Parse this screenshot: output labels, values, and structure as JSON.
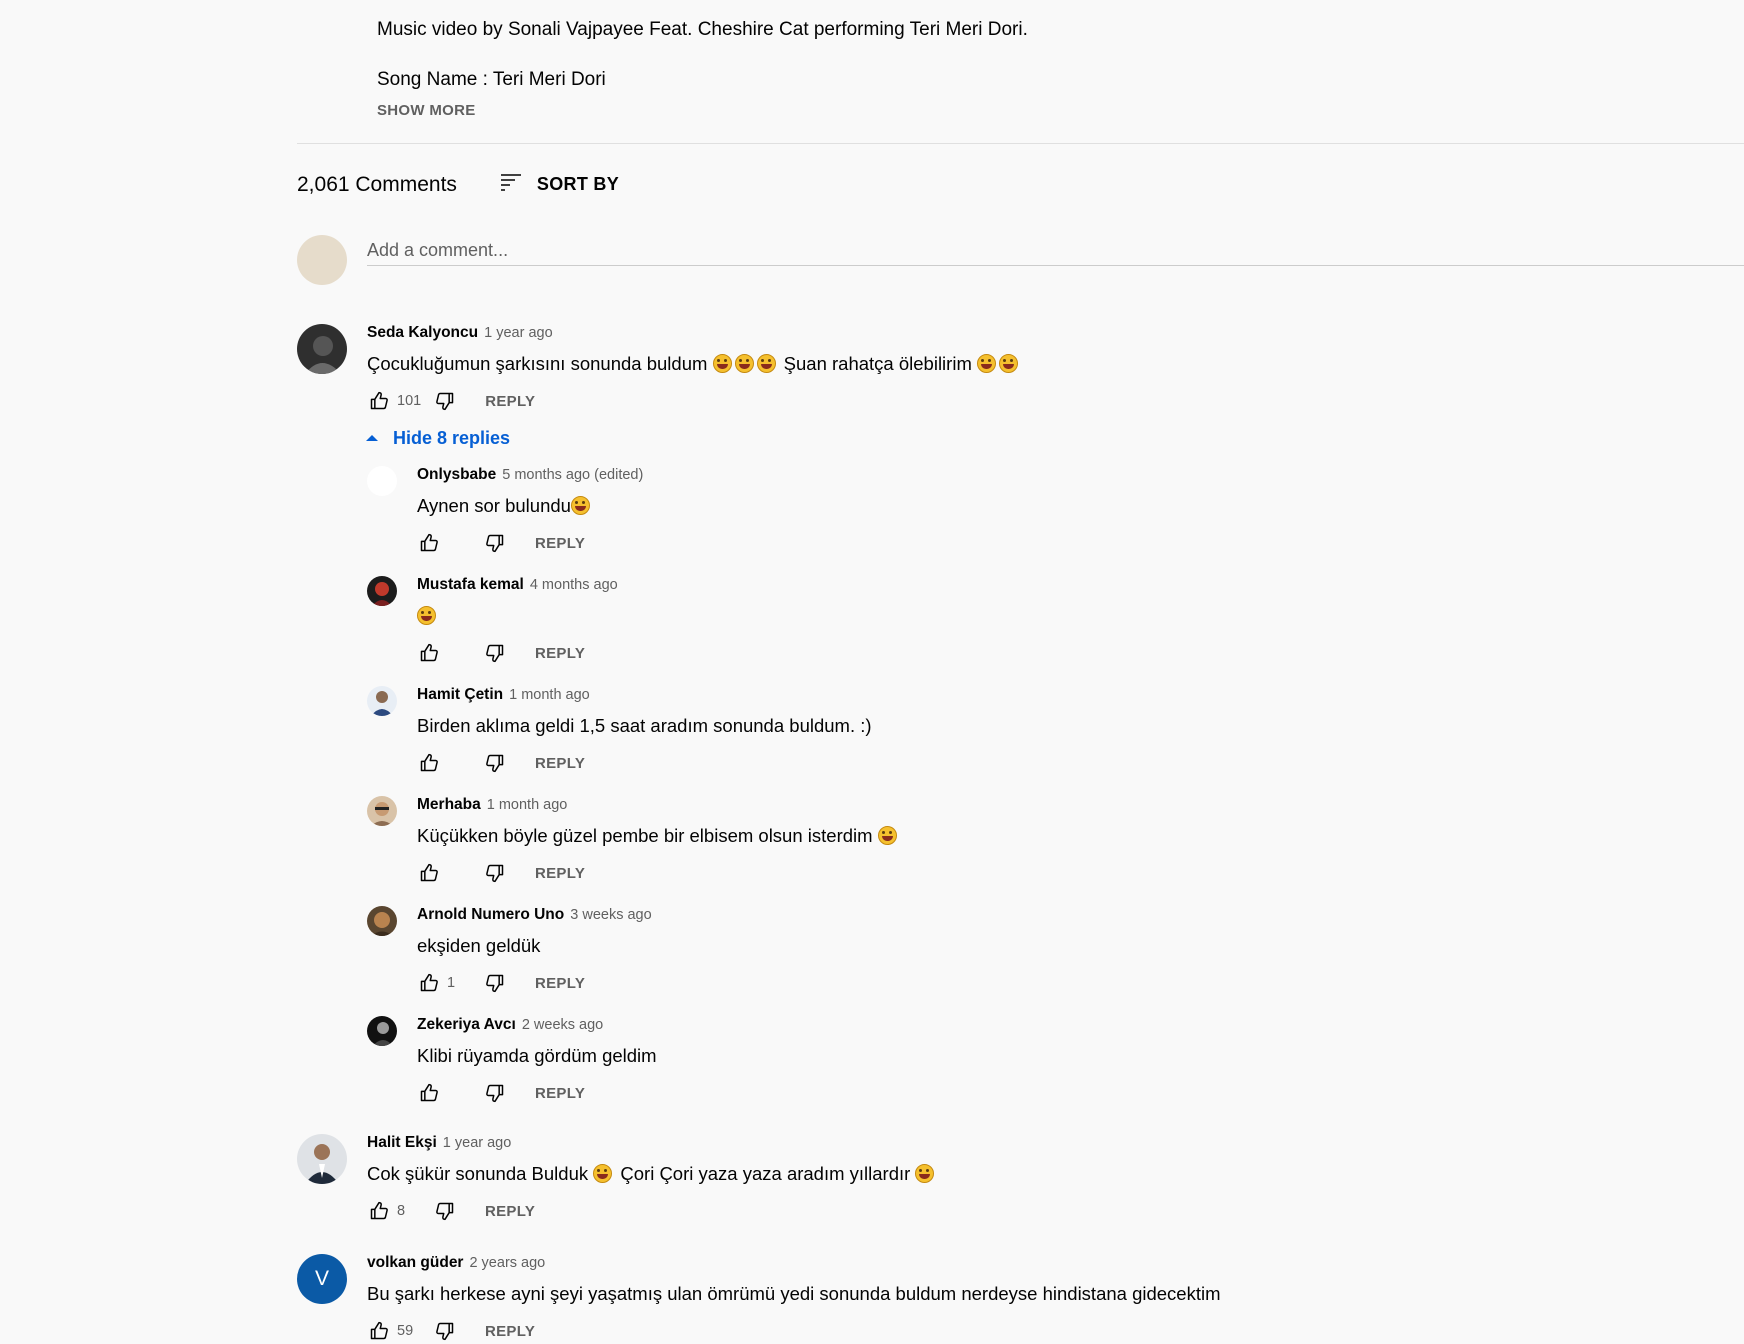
{
  "description": {
    "line1": "Music video by Sonali Vajpayee Feat. Cheshire Cat performing Teri Meri Dori.",
    "line2": "Song Name : Teri Meri Dori",
    "show_more": "SHOW MORE"
  },
  "comments_header": {
    "count": "2,061 Comments",
    "sort_label": "SORT BY"
  },
  "add_comment": {
    "placeholder": "Add a comment..."
  },
  "toggle_replies": "Hide 8 replies",
  "reply_label": "REPLY",
  "comments": [
    {
      "author": "Seda Kalyoncu",
      "time": "1 year ago",
      "text": "Çocukluğumun şarkısını sonunda buldum",
      "text2": "Şuan rahatça ölebilirim",
      "likes": "101"
    },
    {
      "author": "Halit Ekşi",
      "time": "1 year ago",
      "text": "Cok şükür sonunda Bulduk",
      "text2": "Çori Çori yaza yaza aradım yıllardır",
      "likes": "8"
    },
    {
      "author": "volkan güder",
      "time": "2 years ago",
      "text": "Bu şarkı herkese ayni şeyi yaşatmış ulan ömrümü yedi sonunda buldum nerdeyse hindistana gidecektim",
      "likes": "59",
      "avatar_letter": "V"
    }
  ],
  "replies": [
    {
      "author": "Onlysbabe",
      "time": "5 months ago (edited)",
      "text": "Aynen sor bulundu",
      "likes": ""
    },
    {
      "author": "Mustafa kemal",
      "time": "4 months ago",
      "text": "",
      "likes": ""
    },
    {
      "author": "Hamit Çetin",
      "time": "1 month ago",
      "text": "Birden aklıma geldi 1,5 saat aradım sonunda buldum. :)",
      "likes": ""
    },
    {
      "author": "Merhaba",
      "time": "1 month ago",
      "text": "Küçükken böyle güzel pembe bir elbisem olsun isterdim",
      "likes": ""
    },
    {
      "author": "Arnold Numero Uno",
      "time": "3 weeks ago",
      "text": "ekşiden geldük",
      "likes": "1"
    },
    {
      "author": "Zekeriya Avcı",
      "time": "2 weeks ago",
      "text": "Klibi rüyamda gördüm geldim",
      "likes": ""
    }
  ],
  "colors": {
    "link_blue": "#065fd4",
    "background": "#f9f9f9",
    "secondary_text": "#606060"
  }
}
